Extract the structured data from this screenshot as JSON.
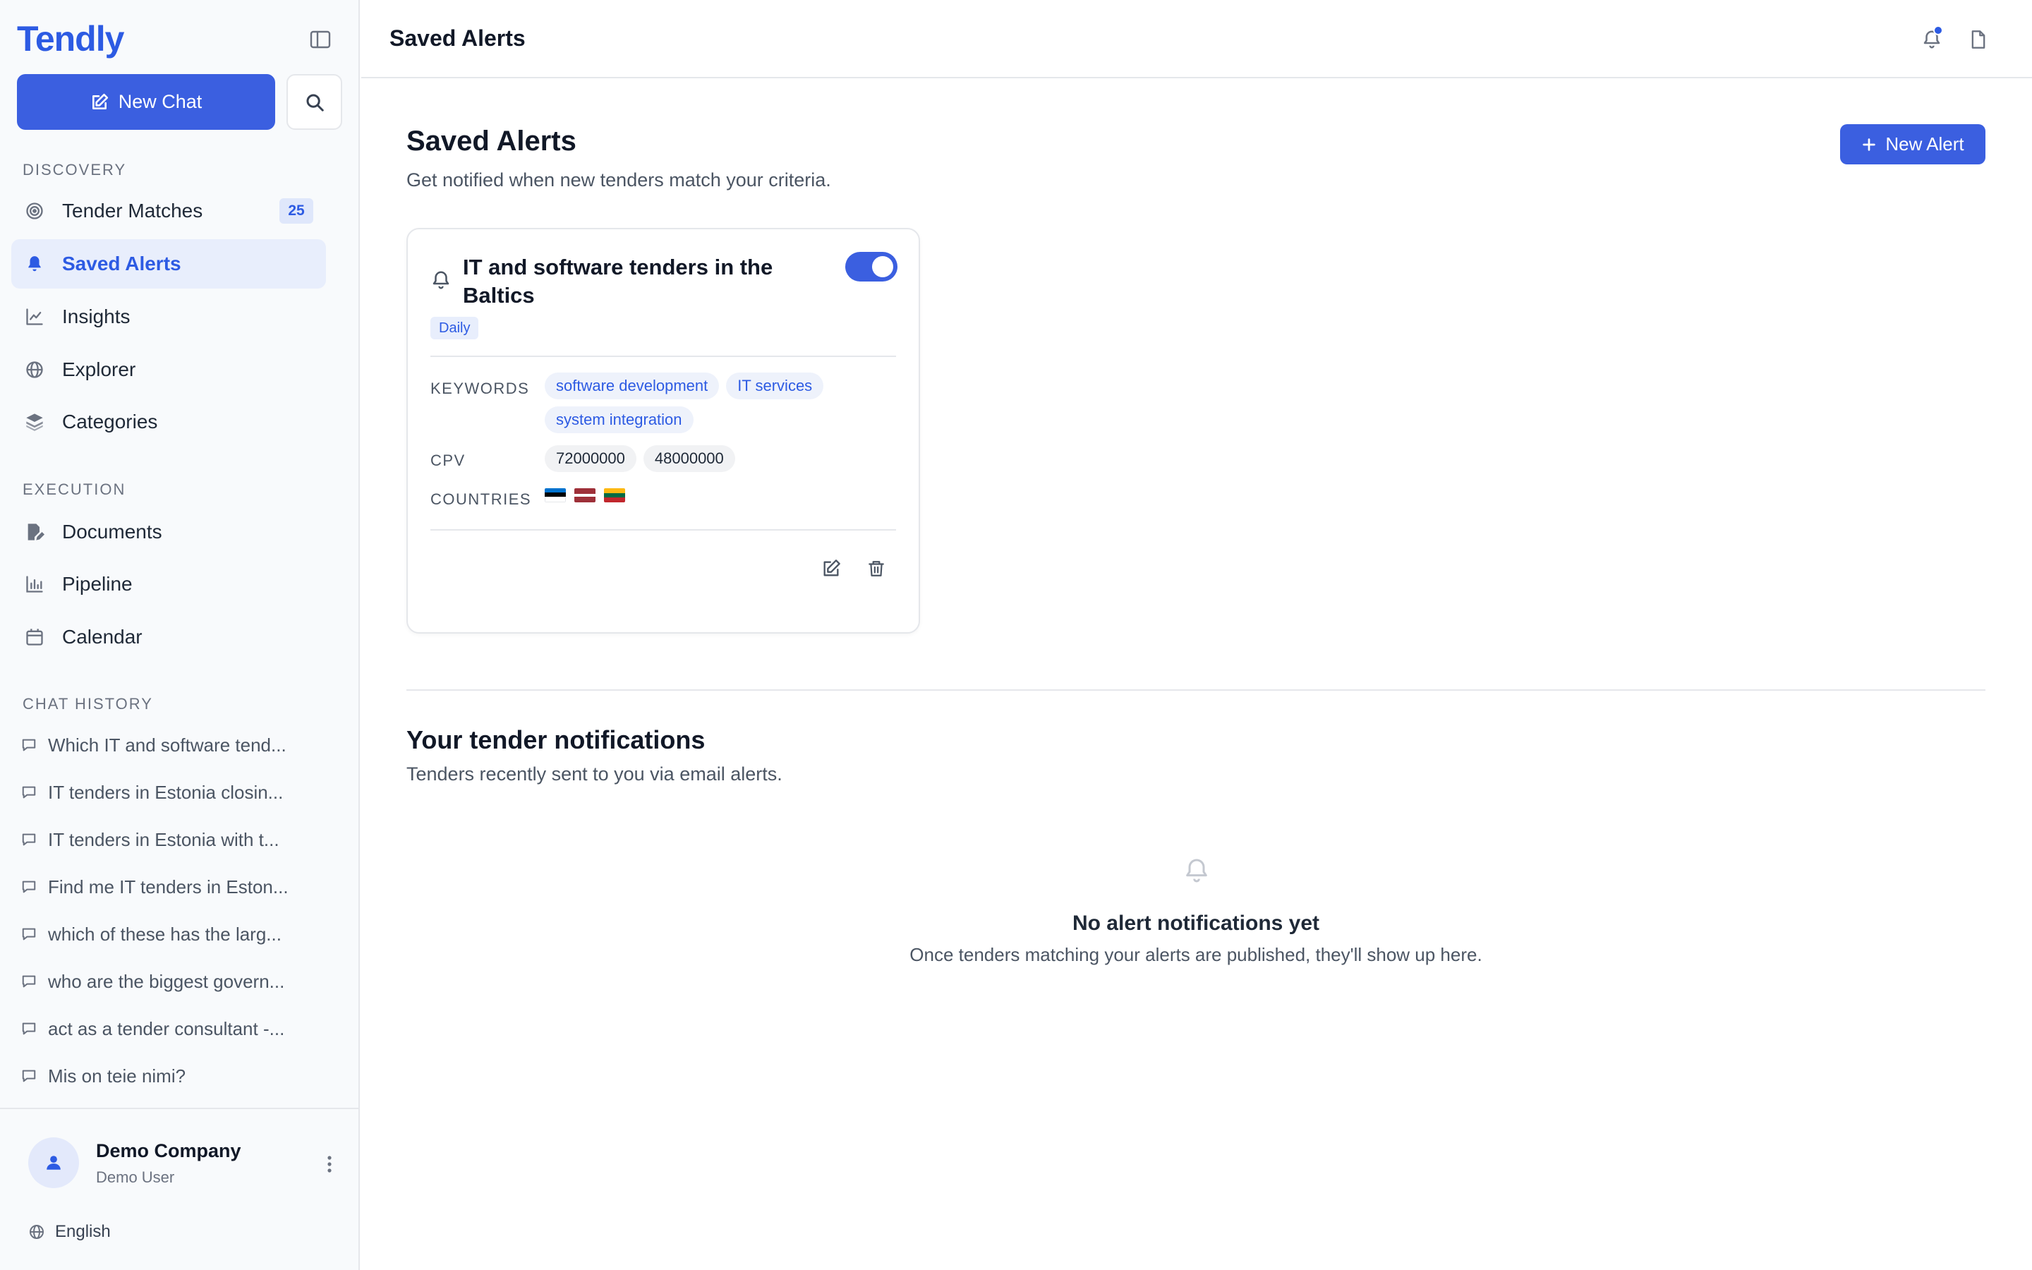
{
  "app": {
    "logo": "Tendly"
  },
  "sidebar": {
    "new_chat_label": "New Chat",
    "discovery_label": "Discovery",
    "discovery_items": [
      {
        "label": "Tender Matches",
        "icon": "target-icon",
        "badge": "25"
      },
      {
        "label": "Saved Alerts",
        "icon": "bell-icon",
        "active": true
      },
      {
        "label": "Insights",
        "icon": "line-chart-icon"
      },
      {
        "label": "Explorer",
        "icon": "globe-icon"
      },
      {
        "label": "Categories",
        "icon": "layers-icon"
      }
    ],
    "execution_label": "Execution",
    "execution_items": [
      {
        "label": "Documents",
        "icon": "document-edit-icon"
      },
      {
        "label": "Pipeline",
        "icon": "bar-chart-icon"
      },
      {
        "label": "Calendar",
        "icon": "calendar-icon"
      }
    ],
    "history_label": "Chat History",
    "history": [
      "Which IT and software tend...",
      "IT tenders in Estonia closin...",
      "IT tenders in Estonia with t...",
      "Find me IT tenders in Eston...",
      "which of these has the larg...",
      "who are the biggest govern...",
      "act as a tender consultant -...",
      "Mis on teie nimi?"
    ],
    "footer": {
      "company": "Demo Company",
      "user": "Demo User",
      "language": "English"
    }
  },
  "topbar": {
    "title": "Saved Alerts"
  },
  "main": {
    "title": "Saved Alerts",
    "subtitle": "Get notified when new tenders match your criteria.",
    "new_alert_label": "New Alert",
    "alert": {
      "title": "IT and software tenders in the Baltics",
      "frequency": "Daily",
      "enabled": true,
      "keywords_label": "Keywords",
      "keywords": [
        "software development",
        "IT services",
        "system integration"
      ],
      "cpv_label": "CPV",
      "cpv": [
        "72000000",
        "48000000"
      ],
      "countries_label": "Countries",
      "countries": [
        {
          "code": "EE",
          "colors": [
            "#0072ce",
            "#000000",
            "#ffffff"
          ]
        },
        {
          "code": "LV",
          "colors": [
            "#9e3039",
            "#ffffff",
            "#9e3039"
          ]
        },
        {
          "code": "LT",
          "colors": [
            "#fdb913",
            "#006a44",
            "#c1272d"
          ]
        }
      ]
    },
    "notifications": {
      "title": "Your tender notifications",
      "subtitle": "Tenders recently sent to you via email alerts.",
      "empty_title": "No alert notifications yet",
      "empty_subtitle": "Once tenders matching your alerts are published, they'll show up here."
    }
  },
  "colors": {
    "accent": "#3b5fe0",
    "accent_text": "#2d5be3",
    "active_bg": "#e8eefc"
  }
}
